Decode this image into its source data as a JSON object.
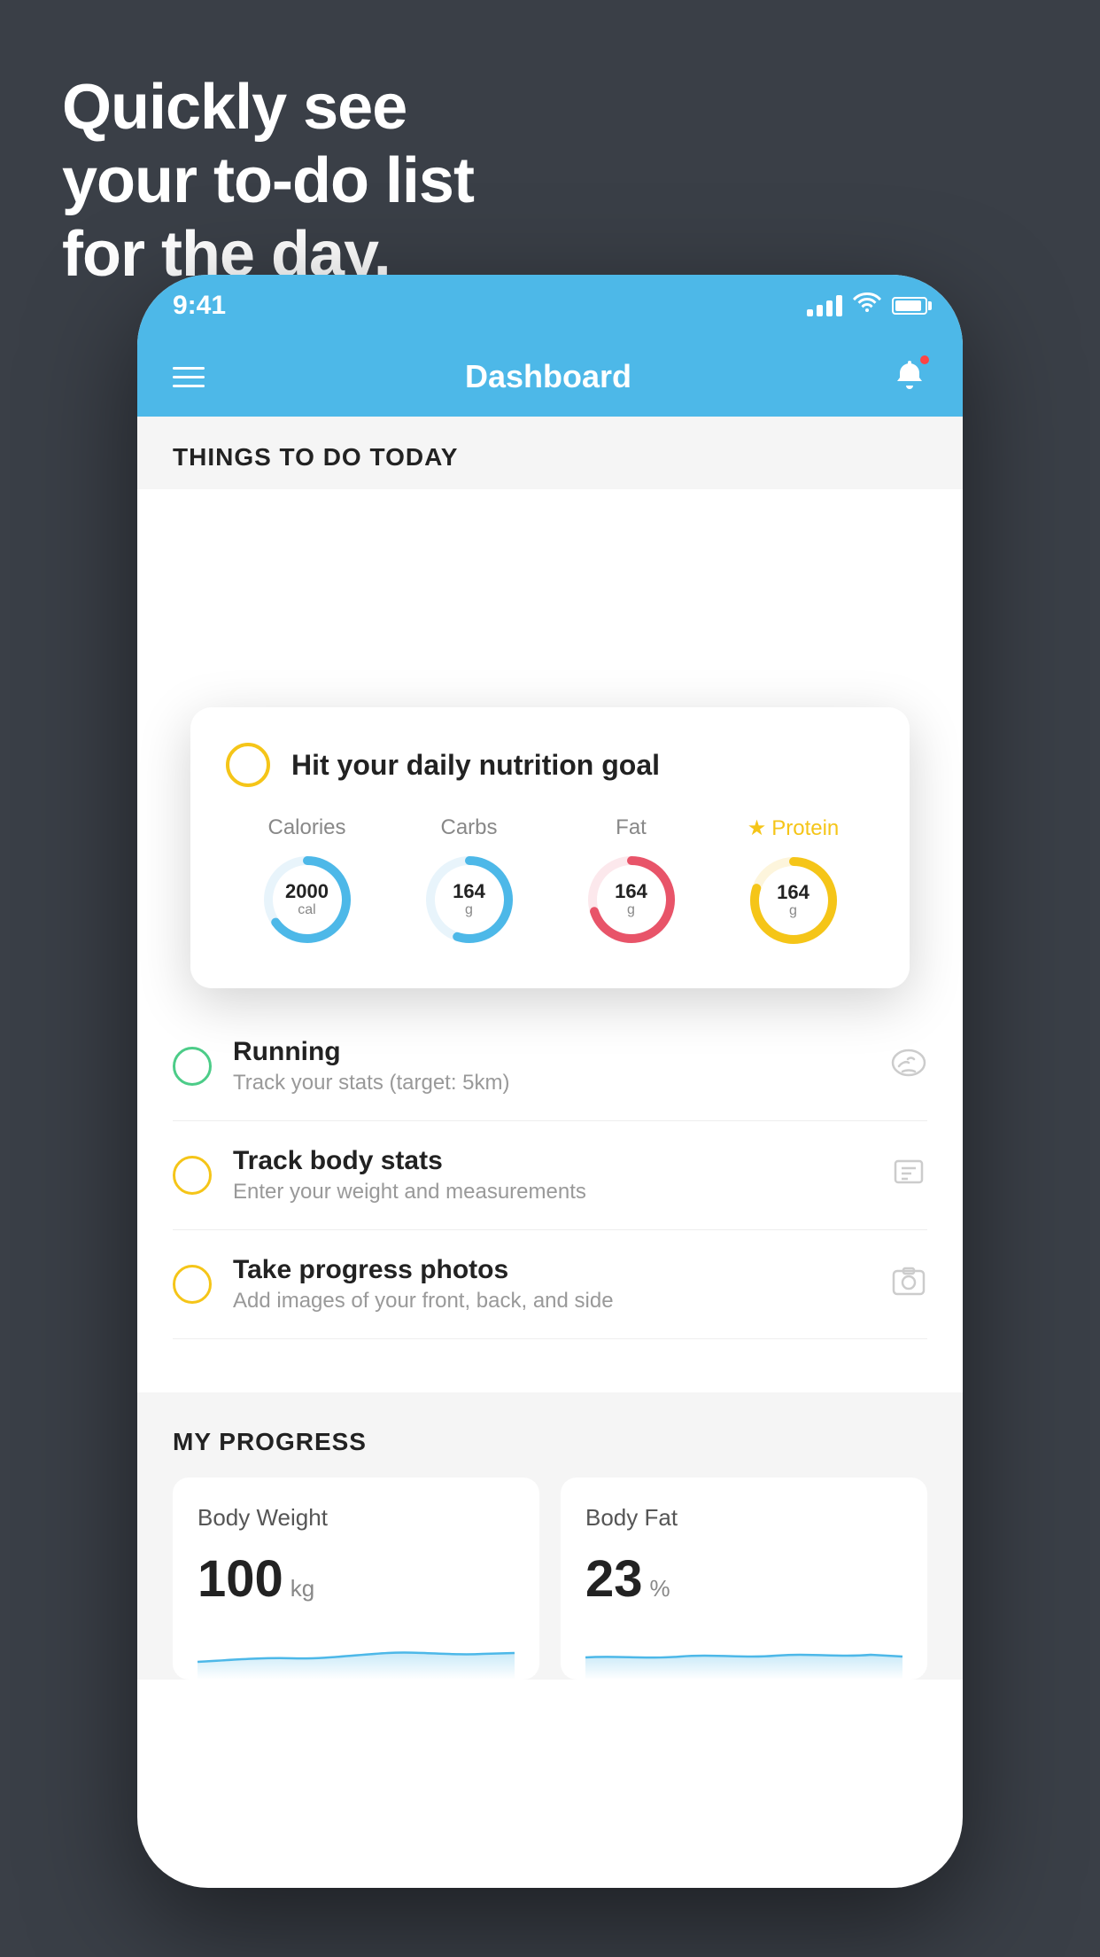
{
  "page": {
    "background": "#3a3f47"
  },
  "hero": {
    "line1": "Quickly see",
    "line2": "your to-do list",
    "line3": "for the day."
  },
  "status_bar": {
    "time": "9:41"
  },
  "header": {
    "title": "Dashboard"
  },
  "section_today": {
    "label": "THINGS TO DO TODAY"
  },
  "nutrition_card": {
    "title": "Hit your daily nutrition goal",
    "stats": [
      {
        "label": "Calories",
        "value": "2000",
        "unit": "cal",
        "color": "#4db8e8",
        "percent": 65,
        "star": false
      },
      {
        "label": "Carbs",
        "value": "164",
        "unit": "g",
        "color": "#4db8e8",
        "percent": 55,
        "star": false
      },
      {
        "label": "Fat",
        "value": "164",
        "unit": "g",
        "color": "#e85469",
        "percent": 70,
        "star": false
      },
      {
        "label": "Protein",
        "value": "164",
        "unit": "g",
        "color": "#f5c518",
        "percent": 80,
        "star": true
      }
    ]
  },
  "todo_items": [
    {
      "title": "Running",
      "subtitle": "Track your stats (target: 5km)",
      "circle_color": "green",
      "icon": "👟"
    },
    {
      "title": "Track body stats",
      "subtitle": "Enter your weight and measurements",
      "circle_color": "yellow",
      "icon": "⊡"
    },
    {
      "title": "Take progress photos",
      "subtitle": "Add images of your front, back, and side",
      "circle_color": "yellow",
      "icon": "👤"
    }
  ],
  "progress": {
    "section_label": "MY PROGRESS",
    "cards": [
      {
        "title": "Body Weight",
        "value": "100",
        "unit": "kg"
      },
      {
        "title": "Body Fat",
        "value": "23",
        "unit": "%"
      }
    ]
  }
}
